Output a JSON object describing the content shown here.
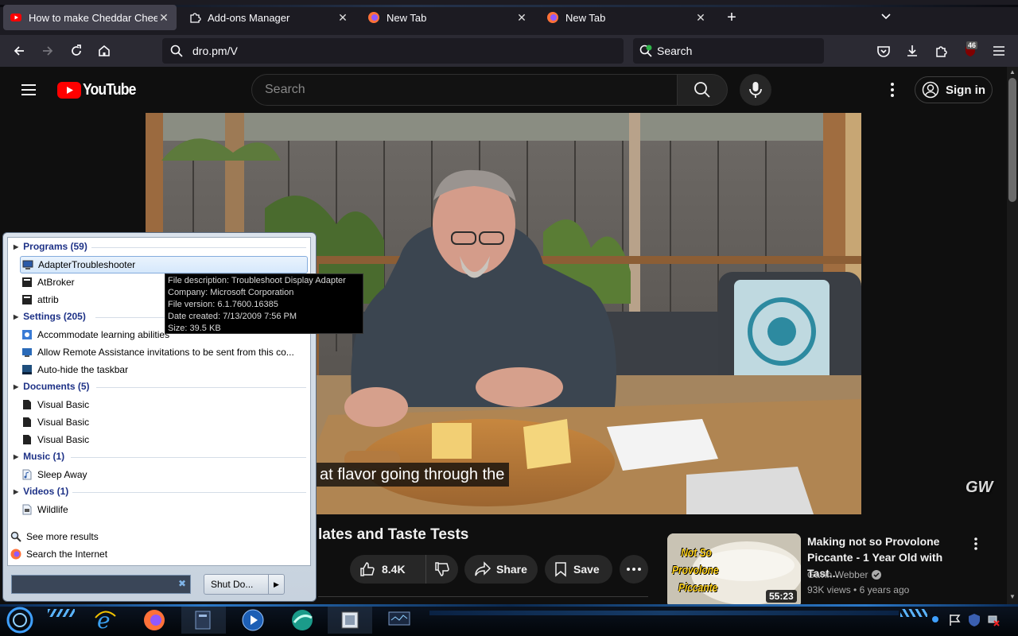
{
  "browser": {
    "tabs": [
      {
        "title": "How to make Cheddar Cheese",
        "active": true
      },
      {
        "title": "Add-ons Manager",
        "active": false
      },
      {
        "title": "New Tab",
        "active": false
      },
      {
        "title": "New Tab",
        "active": false
      }
    ],
    "url": "dro.pm/V",
    "search_placeholder": "Search",
    "extension_badge": "46"
  },
  "youtube": {
    "logo_text": "YouTube",
    "search_placeholder": "Search",
    "signin_label": "Sign in",
    "caption": "at flavor going through the",
    "video_title": "lates and Taste Tests",
    "watermark": "GW",
    "actions": {
      "likes": "8.4K",
      "share": "Share",
      "save": "Save"
    },
    "recommendation": {
      "title": "Making not so Provolone Piccante - 1 Year Old with Tast...",
      "channel": "Gavin Webber",
      "views": "93K views",
      "age": "6 years ago",
      "duration": "55:23",
      "thumb_text": [
        "Not So",
        "Provolone",
        "Piccante"
      ]
    }
  },
  "startmenu": {
    "groups": [
      {
        "label": "Programs (59)",
        "items": [
          "AdapterTroubleshooter",
          "AtBroker",
          "attrib"
        ]
      },
      {
        "label": "Settings (205)",
        "items": [
          "Accommodate learning abilities",
          "Allow Remote Assistance invitations to be sent from this co...",
          "Auto-hide the taskbar"
        ]
      },
      {
        "label": "Documents (5)",
        "items": [
          "Visual Basic",
          "Visual Basic",
          "Visual Basic"
        ]
      },
      {
        "label": "Music (1)",
        "items": [
          "Sleep Away"
        ]
      },
      {
        "label": "Videos (1)",
        "items": [
          "Wildlife"
        ]
      }
    ],
    "see_more": "See more results",
    "search_internet": "Search the Internet",
    "shutdown": "Shut Do...",
    "tooltip": [
      "File description: Troubleshoot Display Adapter",
      "Company: Microsoft Corporation",
      "File version: 6.1.7600.16385",
      "Date created: 7/13/2009 7:56 PM",
      "Size: 39.5 KB"
    ]
  },
  "colors": {
    "yt_red": "#ff0000",
    "firefox_bg": "#1c1b22",
    "yt_bg": "#0f0f0f",
    "startmenu_link": "#1e3287"
  },
  "taskbar": {
    "icons": [
      "start-orb-icon",
      "internet-explorer-icon",
      "firefox-icon",
      "app-icon",
      "media-player-icon",
      "browser-icon",
      "window-icon",
      "network-monitor-icon"
    ]
  }
}
